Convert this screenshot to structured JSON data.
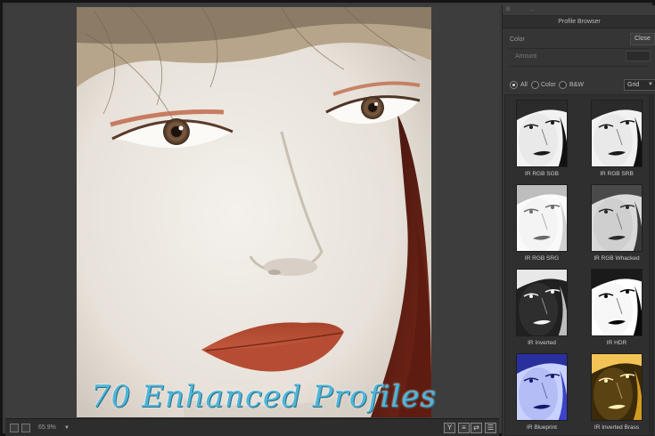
{
  "canvas": {
    "overlay_title": "70 Enhanced Profiles"
  },
  "statusbar": {
    "zoom_value": "65.9%"
  },
  "panel": {
    "top_strip_left": "B:",
    "top_strip_right": "...",
    "header": "Profile Browser",
    "color_label": "Color",
    "close_label": "Close",
    "amount_label": "Amount",
    "filters": [
      {
        "label": "All",
        "selected": true
      },
      {
        "label": "Color",
        "selected": false
      },
      {
        "label": "B&W",
        "selected": false
      }
    ],
    "view_select": "Grid",
    "profiles": [
      {
        "label": "IR RGB SGB",
        "style": "bw-high"
      },
      {
        "label": "IR RGB SRB",
        "style": "bw-high"
      },
      {
        "label": "IR RGB SRG",
        "style": "bw-light"
      },
      {
        "label": "IR RGB Whacked",
        "style": "bw-mid"
      },
      {
        "label": "IR Inverted",
        "style": "inverted"
      },
      {
        "label": "IR HDR",
        "style": "bw-contrast"
      },
      {
        "label": "IR Blueprint",
        "style": "blueprint"
      },
      {
        "label": "IR Inverted Brass",
        "style": "brass"
      }
    ]
  },
  "colors": {
    "overlay_title": "#4fb6d8",
    "panel_bg": "#353535",
    "canvas_bg": "#3d3d3d"
  }
}
